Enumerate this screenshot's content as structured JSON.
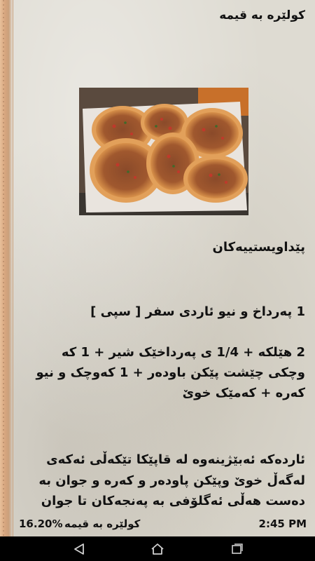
{
  "recipe": {
    "title": "کولێره‌ به‌ قیمه‌",
    "ingredients_heading": "پێداویستییه‌کان",
    "ingredient_1": "1 په‌رداخ و نیو ئاردی سفر [ سپی ]",
    "ingredient_2_lines": [
      "2 هێلکه‌ + 1/4 ی په‌رداخێک شیر + 1 که‌",
      "وچکی چێشت پێکن باوده‌ر + 1 که‌وچک و نیو",
      "که‌ره‌ + که‌مێک خوێ"
    ],
    "method_lines": [
      "ئارده‌که‌ ئه‌بێژینه‌وه‌ له‌ قاپێکا تێکه‌ڵی ئه‌که‌ی",
      "له‌گه‌ڵ خوێ وپێکن پاوده‌ر و که‌ره‌ و جوان به‌",
      "ده‌ست هه‌ڵی ئه‌گلۆفی به‌ په‌نجه‌كان تا جوان"
    ]
  },
  "status_bar": {
    "progress": "16.20%",
    "chapter": "کولێره‌ به‌ قیمه‌",
    "time": "2:45 PM"
  },
  "nav": {
    "back": "back-icon",
    "home": "home-icon",
    "recents": "recents-icon"
  }
}
